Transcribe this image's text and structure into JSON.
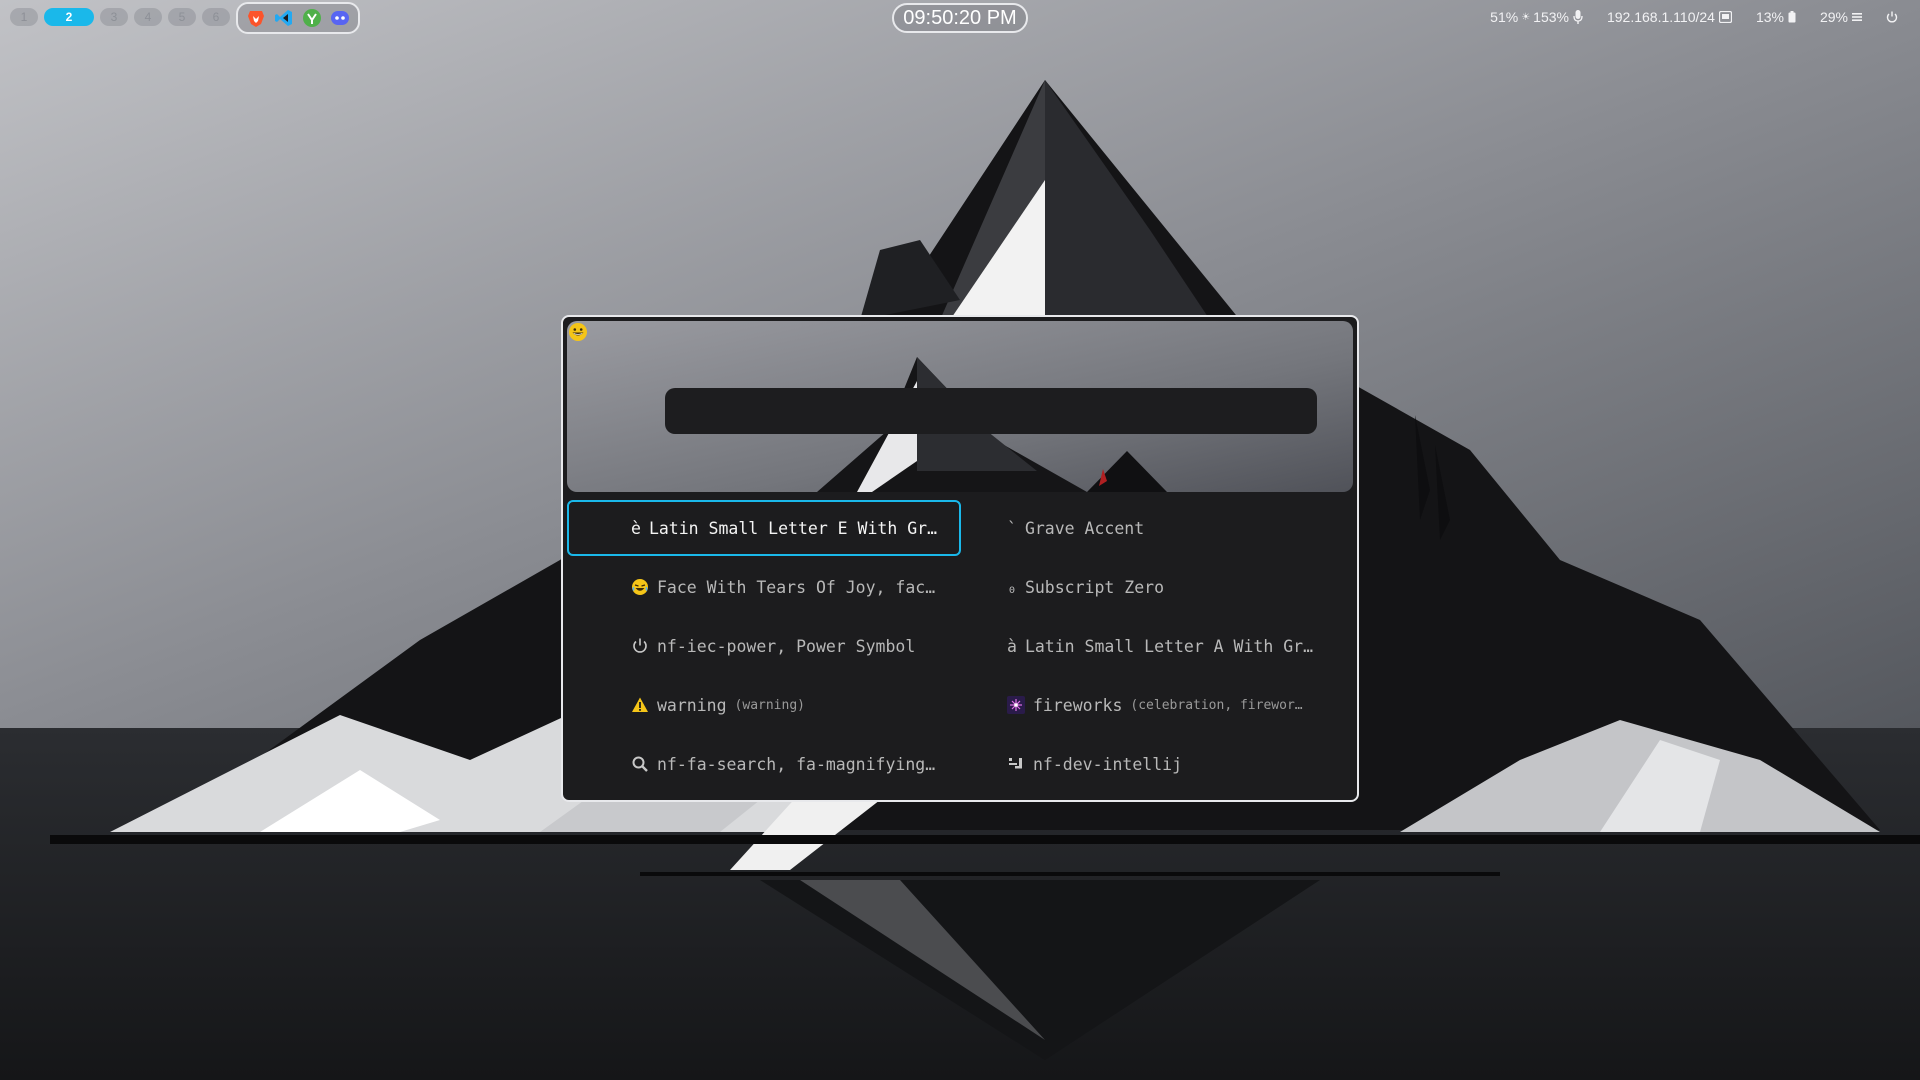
{
  "workspaces": [
    {
      "label": "1"
    },
    {
      "label": "2"
    },
    {
      "label": "3"
    },
    {
      "label": "4"
    },
    {
      "label": "5"
    },
    {
      "label": "6"
    }
  ],
  "tray_apps": [
    {
      "name": "brave-browser-icon"
    },
    {
      "name": "vscode-icon"
    },
    {
      "name": "upwork-icon"
    },
    {
      "name": "discord-icon"
    }
  ],
  "clock": "09:50:20 PM",
  "status": {
    "brightness": "51%",
    "mic_volume": "153%",
    "ip_address": "192.168.1.110/24",
    "battery": "13%",
    "memory": "29%"
  },
  "launcher": {
    "search_value": "",
    "prompt_icon": "grinning-face-emoji-icon",
    "results": [
      {
        "glyph": "è",
        "name": "Latin Small Letter E With Gr…",
        "keywords": ""
      },
      {
        "glyph": "`",
        "name": "Grave Accent",
        "keywords": ""
      },
      {
        "glyph": "😂",
        "name": "Face With Tears Of Joy, fac…",
        "keywords": ""
      },
      {
        "glyph": "₀",
        "name": "Subscript Zero",
        "keywords": ""
      },
      {
        "glyph": "⏻",
        "name": "nf-iec-power, Power Symbol",
        "keywords": ""
      },
      {
        "glyph": "à",
        "name": "Latin Small Letter A With Gr…",
        "keywords": ""
      },
      {
        "glyph": "⚠️",
        "name": "warning",
        "keywords": "(warning)"
      },
      {
        "glyph": "🎆",
        "name": "fireworks",
        "keywords": "(celebration, firewor…"
      },
      {
        "glyph": "🔍",
        "name": "nf-fa-search, fa-magnifying…",
        "keywords": ""
      },
      {
        "glyph": "",
        "name": "nf-dev-intellij",
        "keywords": ""
      }
    ]
  },
  "colors": {
    "accent": "#1ab8ea",
    "panel": "#1c1c1e",
    "border": "#e8e9ec"
  }
}
